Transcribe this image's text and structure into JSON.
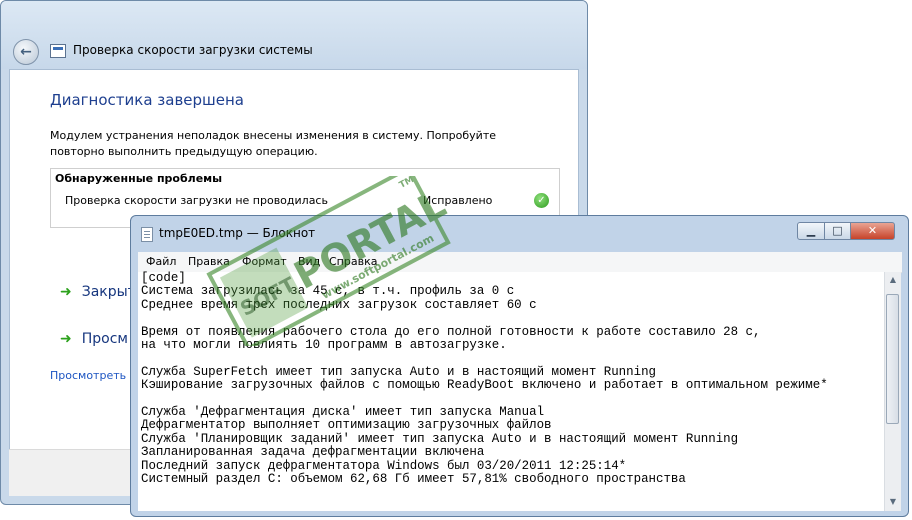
{
  "troubleshooter": {
    "title": "Проверка скорости загрузки системы",
    "heading": "Диагностика завершена",
    "description": "Модулем устранения неполадок внесены изменения в систему. Попробуйте повторно выполнить предыдущую операцию.",
    "problems_title": "Обнаруженные проблемы",
    "problem": "Проверка скорости загрузки не проводилась",
    "problem_status": "Исправлено",
    "action1": "Закрыт",
    "action2": "Просм",
    "link": "Просмотреть д"
  },
  "notepad": {
    "title": "tmpE0ED.tmp — Блокнот",
    "menu": [
      "Файл",
      "Правка",
      "Формат",
      "Вид",
      "Справка"
    ],
    "lines": [
      "[code]",
      "Система загрузилась за 45 с, в т.ч. профиль за 0 с",
      "Среднее время трех последних загрузок составляет 60 с",
      "",
      "Время от появления рабочего стола до его полной готовности к работе составило 28 с,",
      "на что могли повлиять 10 программ в автозагрузке.",
      "",
      "Служба SuperFetch имеет тип запуска Auto и в настоящий момент Running",
      "Кэширование загрузочных файлов с помощью ReadyBoot включено и работает в оптимальном режиме*",
      "",
      "Служба 'Дефрагментация диска' имеет тип запуска Manual",
      "Дефрагментатор выполняет оптимизацию загрузочных файлов",
      "Служба 'Планировщик заданий' имеет тип запуска Auto и в настоящий момент Running",
      "Запланированная задача дефрагментации включена",
      "Последний запуск дефрагментатора Windows был 03/20/2011 12:25:14*",
      "Системный раздел C: объемом 62,68 Гб имеет 57,81% свободного пространства"
    ]
  },
  "watermark": {
    "brand": "PORTAL",
    "soft": "SOFT",
    "url": "www.softportal.com",
    "tm": "TM"
  }
}
